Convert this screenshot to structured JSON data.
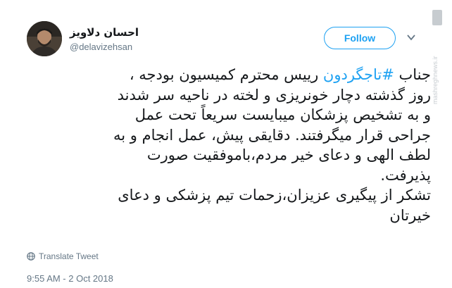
{
  "user": {
    "display_name": "احسان دلاویز",
    "handle": "@delavizehsan"
  },
  "follow_button": {
    "label": "Follow"
  },
  "tweet": {
    "lines": [
      {
        "before": "جناب ",
        "hashtag": "#تاجگردون",
        "after": " رییس محترم کمیسیون بودجه ،"
      },
      {
        "text": "روز گذشته دچار خونریزی و لخته در ناحیه سر شدند"
      },
      {
        "text": "و به تشخیص پزشکان میبایست سریعاً تحت عمل"
      },
      {
        "text": "جراحی قرار میگرفتند. دقایقی پیش، عمل انجام و به"
      },
      {
        "text": "لطف الهی و دعای خیر مردم،باموفقیت صورت"
      },
      {
        "text": "پذیرفت."
      },
      {
        "text": "تشکر از پیگیری عزیزان،زحمات تیم پزشکی و دعای"
      },
      {
        "text": "خیرتان"
      }
    ]
  },
  "translate": {
    "label": "Translate Tweet",
    "icon": "globe-icon"
  },
  "timestamp": "9:55 AM - 2 Oct 2018",
  "watermark": {
    "text": "mashreghnews.ir",
    "icon": "news-logo"
  },
  "colors": {
    "accent": "#1da1f2",
    "text": "#14171a",
    "secondary": "#657786"
  }
}
